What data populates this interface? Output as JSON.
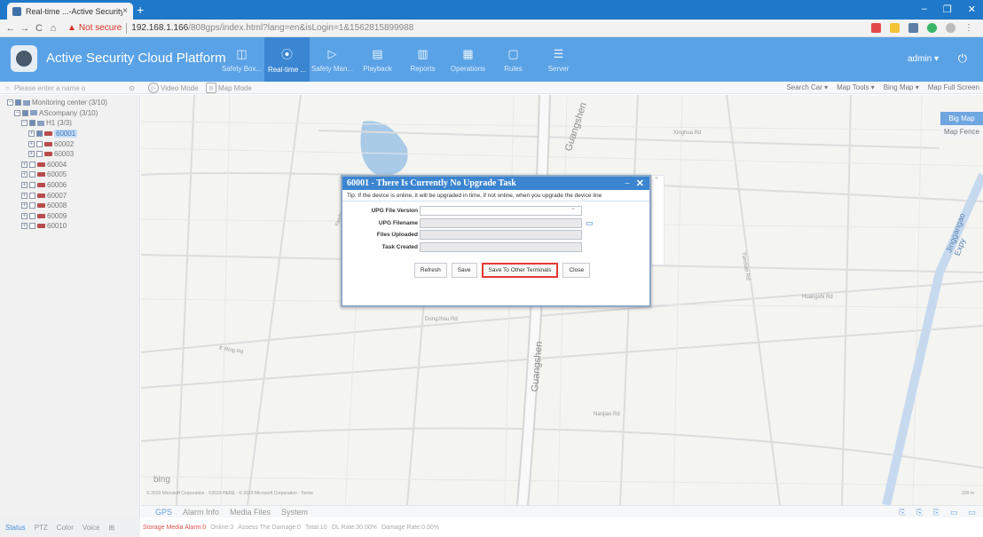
{
  "browser": {
    "tab_title": "Real-time ...-Active Security Cl",
    "tab_close": "×",
    "new_tab": "+",
    "nav_back": "←",
    "nav_forward": "→",
    "nav_reload": "C",
    "nav_home": "⌂",
    "not_secure": "Not secure",
    "url_host": "192.168.1.166",
    "url_path": "/808gps/index.html?lang=en&isLogin=1&1562815899988",
    "win_min": "–",
    "win_max": "❐",
    "win_close": "✕"
  },
  "app": {
    "title": "Active Security Cloud Platform",
    "menu": [
      {
        "label": "Safety Box...",
        "icon": "◫"
      },
      {
        "label": "Real-time ...",
        "icon": "⦿"
      },
      {
        "label": "Safety Man...",
        "icon": "▷"
      },
      {
        "label": "Playback",
        "icon": "▤"
      },
      {
        "label": "Reports",
        "icon": "▥"
      },
      {
        "label": "Operations",
        "icon": "▦"
      },
      {
        "label": "Rules",
        "icon": "▢"
      },
      {
        "label": "Server",
        "icon": "☰"
      }
    ],
    "user": "admin ▾",
    "power_icon": "⏻"
  },
  "toolbar": {
    "search_placeholder": "Please enter a name o",
    "video_mode": "Video Mode",
    "map_mode": "Map Mode",
    "search_car": "Search Car ▾",
    "map_tools": "Map Tools ▾",
    "bing_map": "Bing Map ▾",
    "full_screen": "Map Full Screen"
  },
  "tree": [
    {
      "label": "Monitoring center (3/10)",
      "indent": 0,
      "kind": "dir",
      "checked": true,
      "toggle": "−"
    },
    {
      "label": "AScompany (3/10)",
      "indent": 1,
      "kind": "dir",
      "checked": true,
      "toggle": "−"
    },
    {
      "label": "H1 (3/3)",
      "indent": 2,
      "kind": "dir",
      "checked": true,
      "toggle": "−"
    },
    {
      "label": "60001",
      "indent": 3,
      "kind": "dev",
      "checked": true,
      "toggle": "+",
      "selected": true
    },
    {
      "label": "60002",
      "indent": 3,
      "kind": "dev",
      "checked": false,
      "toggle": "+"
    },
    {
      "label": "60003",
      "indent": 3,
      "kind": "dev",
      "checked": false,
      "toggle": "+"
    },
    {
      "label": "60004",
      "indent": 2,
      "kind": "dev",
      "checked": false,
      "toggle": "+"
    },
    {
      "label": "60005",
      "indent": 2,
      "kind": "dev",
      "checked": false,
      "toggle": "+"
    },
    {
      "label": "60006",
      "indent": 2,
      "kind": "dev",
      "checked": false,
      "toggle": "+"
    },
    {
      "label": "60007",
      "indent": 2,
      "kind": "dev",
      "checked": false,
      "toggle": "+"
    },
    {
      "label": "60008",
      "indent": 2,
      "kind": "dev",
      "checked": false,
      "toggle": "+"
    },
    {
      "label": "60009",
      "indent": 2,
      "kind": "dev",
      "checked": false,
      "toggle": "+"
    },
    {
      "label": "60010",
      "indent": 2,
      "kind": "dev",
      "checked": false,
      "toggle": "+"
    }
  ],
  "left_tabs": [
    "Status",
    "PTZ",
    "Color",
    "Voice",
    "⊞"
  ],
  "map": {
    "tabs": [
      "Big Map",
      "Map Fence"
    ],
    "bing": "bing",
    "copyright": "© 2019 Microsoft Corporation · ©2019 HERE · © 2019 Microsoft Corporation · Terms",
    "scale": "200 m",
    "road_labels": [
      {
        "text": "Guangshen",
        "cls": "big"
      },
      {
        "text": "Guangshen",
        "cls": "big2"
      },
      {
        "text": "Jinggangao Expy",
        "cls": "side"
      },
      {
        "text": "Dongzhou Rd"
      },
      {
        "text": "Huangshi Rd"
      },
      {
        "text": "E Ring Rd"
      },
      {
        "text": "Yandong Rd"
      },
      {
        "text": "Nanjiao Rd"
      },
      {
        "text": "Xinghua Rd"
      },
      {
        "text": "Tiandian Rd"
      }
    ]
  },
  "bottom_tabs": [
    "GPS",
    "Alarm Info",
    "Media Files",
    "System"
  ],
  "bottom_icons": [
    "⎘",
    "⎘",
    "⎘",
    "▭",
    "▭"
  ],
  "status": {
    "alarm": "Storage Media Alarm:0",
    "online": "Online:3",
    "assess": "Assess The Damage:0",
    "total": "Total:10",
    "ol_rate": "OL Rate:30.00%",
    "damage_rate": "Damage Rate:0.00%"
  },
  "dialog": {
    "title": "60001 - There Is Currently No Upgrade Task",
    "minimize": "–",
    "close": "✕",
    "tip": "Tip: If the device is online, it will be upgraded in time, if not online, when you upgrade the device line",
    "fields": [
      {
        "label": "UPG File Version",
        "value": "",
        "type": "select"
      },
      {
        "label": "UPG Filename",
        "value": "",
        "type": "text"
      },
      {
        "label": "Files Uploaded",
        "value": "",
        "type": "text"
      },
      {
        "label": "Task Created",
        "value": "",
        "type": "text"
      }
    ],
    "buttons": {
      "refresh": "Refresh",
      "save": "Save",
      "save_other": "Save To Other Terminals",
      "close": "Close"
    }
  }
}
